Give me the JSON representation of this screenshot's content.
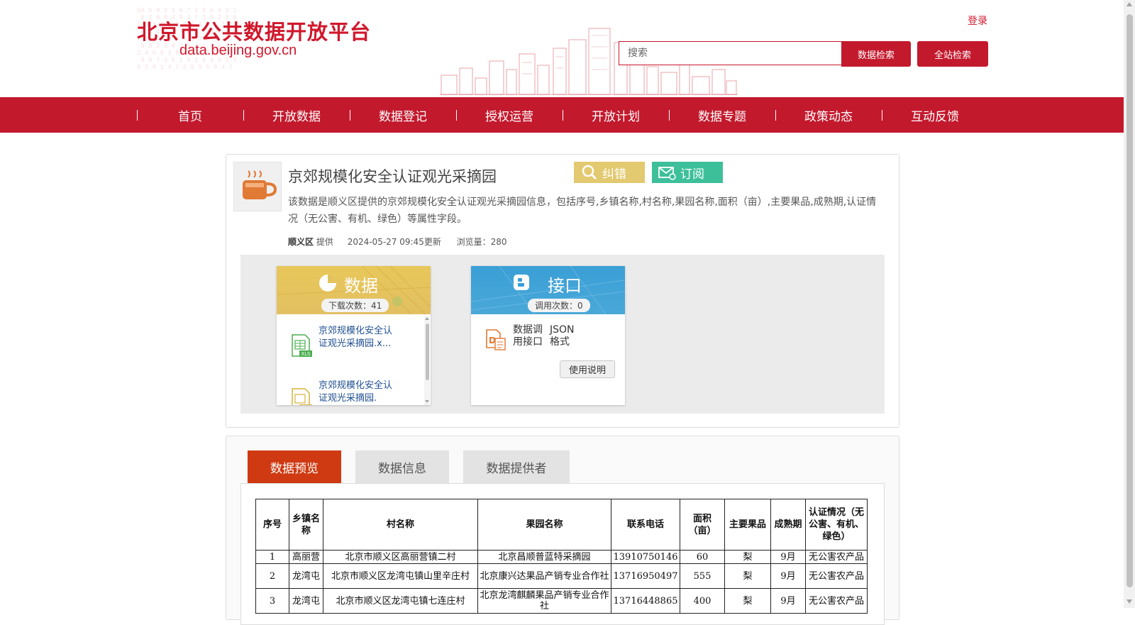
{
  "header": {
    "site_title": "北京市公共数据开放平台",
    "site_domain": "data.beijing.gov.cn",
    "login_label": "登录",
    "search_placeholder": "搜索",
    "data_search_label": "数据检索",
    "site_search_label": "全站检索"
  },
  "nav": {
    "items": [
      "首页",
      "开放数据",
      "数据登记",
      "授权运营",
      "开放计划",
      "数据专题",
      "政策动态",
      "互动反馈"
    ]
  },
  "dataset": {
    "title": "京郊规模化安全认证观光采摘园",
    "correct_label": "纠错",
    "subscribe_label": "订阅",
    "description": "该数据是顺义区提供的京郊规模化安全认证观光采摘园信息，包括序号,乡镇名称,村名称,果园名称,面积（亩）,主要果品,成熟期,认证情况（无公害、有机、绿色）等属性字段。",
    "provider": "顺义区",
    "provider_suffix": "提供",
    "updated": "2024-05-27 09:45更新",
    "views": "浏览量：280"
  },
  "data_card": {
    "title": "数据",
    "downloads": "下载次数：41",
    "files": [
      {
        "name": "京郊规模化安全认证观光采摘园.x...",
        "icon": "xls-file-icon"
      },
      {
        "name": "京郊规模化安全认证观光采摘园.",
        "icon": "file-icon"
      }
    ]
  },
  "api_card": {
    "title": "接口",
    "calls": "调用次数：0",
    "label_line1": "数据调",
    "label_line2": "用接口",
    "format_line1": "JSON",
    "format_line2": "格式",
    "usage_label": "使用说明"
  },
  "tabs": [
    "数据预览",
    "数据信息",
    "数据提供者"
  ],
  "table": {
    "headers": [
      "序号",
      "乡镇名称",
      "村名称",
      "果园名称",
      "联系电话",
      "面积（亩）",
      "主要果品",
      "成熟期",
      "认证情况（无公害、有机、绿色）"
    ],
    "rows": [
      [
        "1",
        "高丽营",
        "北京市顺义区高丽营镇二村",
        "北京昌顺普蓝特采摘园",
        "13910750146",
        "60",
        "梨",
        "9月",
        "无公害农产品"
      ],
      [
        "2",
        "龙湾屯",
        "北京市顺义区龙湾屯镇山里辛庄村",
        "北京康兴达果品产销专业合作社",
        "13716950497",
        "555",
        "梨",
        "9月",
        "无公害农产品"
      ],
      [
        "3",
        "龙湾屯",
        "北京市顺义区龙湾屯镇七连庄村",
        "北京龙湾麒麟果品产销专业合作社",
        "13716448865",
        "400",
        "梨",
        "9月",
        "无公害农产品"
      ]
    ]
  },
  "colors": {
    "brand_red": "#c3192d",
    "correct_btn": "#e3c96f",
    "subscribe_btn": "#3dbf9a",
    "active_tab": "#cf3a12",
    "data_card_header": "#e8c75a",
    "api_card_header": "#3a9fd6"
  }
}
